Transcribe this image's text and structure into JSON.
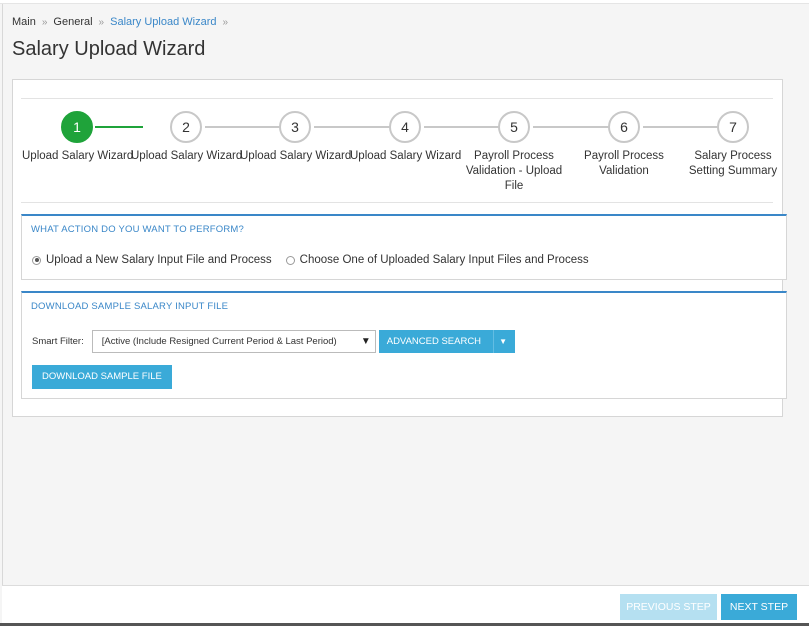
{
  "breadcrumb": {
    "items": [
      "Main",
      "General",
      "Salary Upload Wizard"
    ],
    "separator": "»"
  },
  "page": {
    "title": "Salary Upload Wizard"
  },
  "wizard": {
    "steps": [
      {
        "number": "1",
        "label": "Upload Salary Wizard",
        "state": "done"
      },
      {
        "number": "2",
        "label": "Upload Salary Wizard",
        "state": "pending"
      },
      {
        "number": "3",
        "label": "Upload Salary Wizard",
        "state": "pending"
      },
      {
        "number": "4",
        "label": "Upload Salary Wizard",
        "state": "pending"
      },
      {
        "number": "5",
        "label": "Payroll Process Validation - Upload File",
        "state": "pending"
      },
      {
        "number": "6",
        "label": "Payroll Process Validation",
        "state": "pending"
      },
      {
        "number": "7",
        "label": "Salary Process Setting Summary",
        "state": "pending"
      }
    ]
  },
  "action_section": {
    "title": "WHAT ACTION DO YOU WANT TO PERFORM?",
    "options": [
      {
        "label": "Upload a New Salary Input File and Process",
        "checked": true
      },
      {
        "label": "Choose One of Uploaded Salary Input Files and Process",
        "checked": false
      }
    ]
  },
  "download_section": {
    "title": "DOWNLOAD SAMPLE SALARY INPUT FILE",
    "filter_label": "Smart Filter:",
    "filter_value": "[Active (Include Resigned Current Period & Last Period)",
    "advanced_search_label": "ADVANCED SEARCH",
    "download_label": "DOWNLOAD SAMPLE FILE"
  },
  "footer": {
    "previous_label": "PREVIOUS STEP",
    "next_label": "NEXT STEP"
  },
  "colors": {
    "accent": "#3a87c8",
    "button": "#3aaad8",
    "button_disabled": "#b5e0f1",
    "step_done": "#1fa33a"
  }
}
